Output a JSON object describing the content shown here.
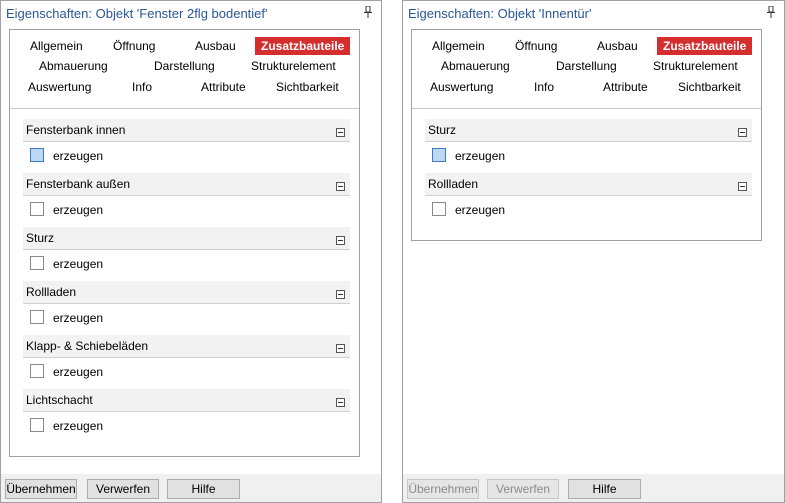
{
  "left": {
    "title": "Eigenschaften: Objekt 'Fenster 2flg bodentief'",
    "tabs": [
      "Allgemein",
      "Öffnung",
      "Ausbau",
      "Zusatzbauteile",
      "Abmauerung",
      "Darstellung",
      "Strukturelement",
      "Auswertung",
      "Info",
      "Attribute",
      "Sichtbarkeit"
    ],
    "active_tab": "Zusatzbauteile",
    "sections": [
      {
        "title": "Fensterbank innen",
        "option": "erzeugen",
        "checked": false
      },
      {
        "title": "Fensterbank außen",
        "option": "erzeugen",
        "checked": false
      },
      {
        "title": "Sturz",
        "option": "erzeugen",
        "checked": false
      },
      {
        "title": "Rollladen",
        "option": "erzeugen",
        "checked": false
      },
      {
        "title": "Klapp- & Schiebeläden",
        "option": "erzeugen",
        "checked": false
      },
      {
        "title": "Lichtschacht",
        "option": "erzeugen",
        "checked": false
      }
    ],
    "buttons": {
      "apply": "Übernehmen",
      "discard": "Verwerfen",
      "help": "Hilfe"
    }
  },
  "right": {
    "title": "Eigenschaften: Objekt 'Innentür'",
    "tabs": [
      "Allgemein",
      "Öffnung",
      "Ausbau",
      "Zusatzbauteile",
      "Abmauerung",
      "Darstellung",
      "Strukturelement",
      "Auswertung",
      "Info",
      "Attribute",
      "Sichtbarkeit"
    ],
    "active_tab": "Zusatzbauteile",
    "sections": [
      {
        "title": "Sturz",
        "option": "erzeugen",
        "checked": false
      },
      {
        "title": "Rollladen",
        "option": "erzeugen",
        "checked": false
      }
    ],
    "buttons": {
      "apply": "Übernehmen",
      "discard": "Verwerfen",
      "help": "Hilfe"
    }
  },
  "colors": {
    "title": "#2b5797",
    "active_tab": "#d42e2e",
    "focus": "#bcd8f3"
  }
}
